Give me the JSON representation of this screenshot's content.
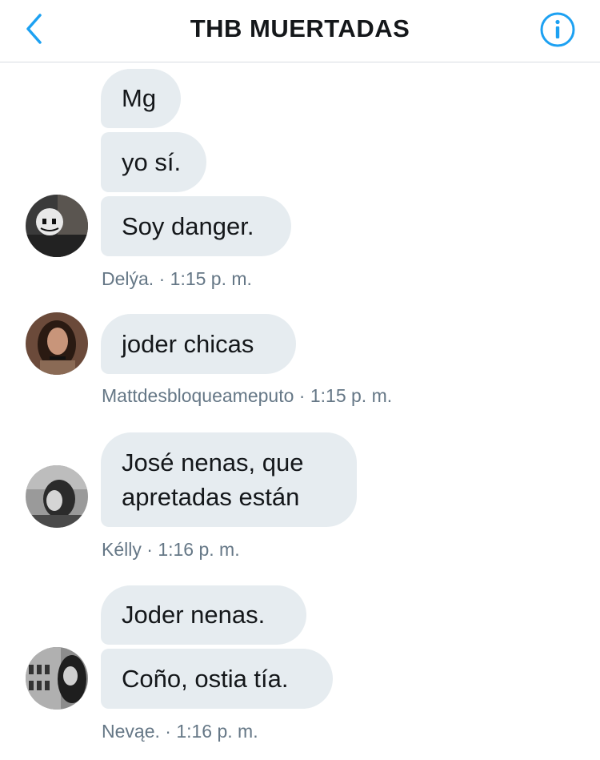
{
  "header": {
    "title": "THB MUERTADAS",
    "back_icon": "chevron-left-icon",
    "info_icon": "info-circle-icon",
    "accent_color": "#1da1f2"
  },
  "groups": [
    {
      "sender": "Delýa.",
      "time": "1:15 p. m.",
      "messages": [
        "Mg",
        "yo sí.",
        "Soy danger."
      ]
    },
    {
      "sender": "Mattdesbloqueameputo",
      "time": "1:15 p. m.",
      "messages": [
        "joder chicas"
      ]
    },
    {
      "sender": "Kélly",
      "time": "1:16 p. m.",
      "messages": [
        "José nenas, que apretadas están"
      ]
    },
    {
      "sender": "Nevąe.",
      "time": "1:16 p. m.",
      "messages": [
        "Joder nenas.",
        "Coño, ostia tía."
      ]
    }
  ],
  "separator": "·",
  "bubble_color": "#e6ecf0",
  "meta_color": "#657786"
}
